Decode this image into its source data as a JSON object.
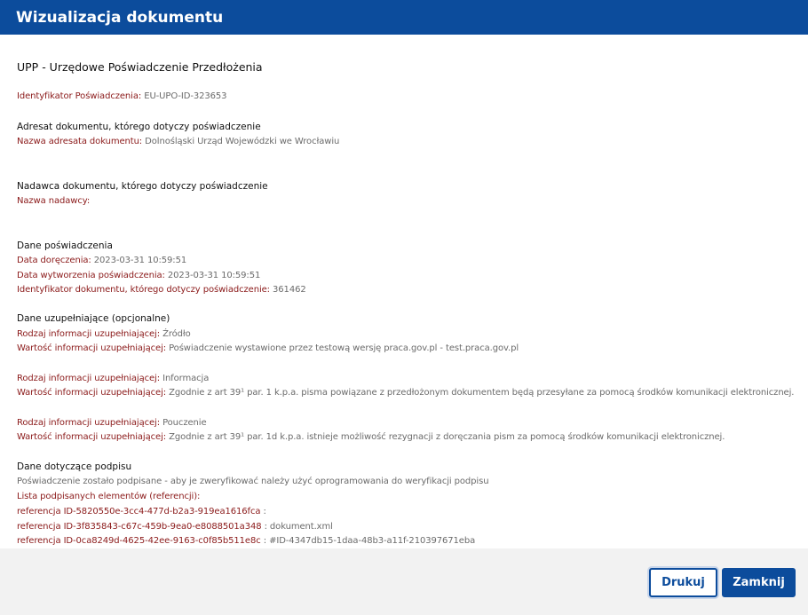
{
  "dialog": {
    "title": "Wizualizacja dokumentu"
  },
  "document": {
    "title": "UPP - Urzędowe Poświadczenie Przedłożenia",
    "identifier": {
      "label": "Identyfikator Poświadczenia:",
      "value": " EU-UPO-ID-323653"
    },
    "recipient": {
      "heading": "Adresat dokumentu, którego dotyczy poświadczenie",
      "name_label": "Nazwa adresata dokumentu:",
      "name_value": " Dolnośląski Urząd Wojewódzki we Wrocławiu"
    },
    "sender": {
      "heading": "Nadawca dokumentu, którego dotyczy poświadczenie",
      "name_label": "Nazwa nadawcy:",
      "name_value": ""
    },
    "certificate": {
      "heading": "Dane poświadczenia",
      "delivery_label": "Data doręczenia:",
      "delivery_value": " 2023-03-31 10:59:51",
      "created_label": "Data wytworzenia poświadczenia:",
      "created_value": " 2023-03-31 10:59:51",
      "docid_label": "Identyfikator dokumentu, którego dotyczy poświadczenie:",
      "docid_value": " 361462"
    },
    "supplementary": {
      "heading": "Dane uzupełniające (opcjonalne)",
      "type_label": "Rodzaj informacji uzupełniającej:",
      "value_label": "Wartość informacji uzupełniającej:",
      "items": [
        {
          "type": " Źródło",
          "value": " Poświadczenie wystawione przez testową wersję praca.gov.pl - test.praca.gov.pl"
        },
        {
          "type": " Informacja",
          "value": " Zgodnie z art 39¹ par. 1 k.p.a. pisma powiązane z przedłożonym dokumentem będą przesyłane za pomocą środków komunikacji elektronicznej."
        },
        {
          "type": " Pouczenie",
          "value": " Zgodnie z art 39¹ par. 1d k.p.a. istnieje możliwość rezygnacji z doręczania pism za pomocą środków komunikacji elektronicznej."
        }
      ]
    },
    "signature": {
      "heading": "Dane dotyczące podpisu",
      "note": "Poświadczenie zostało podpisane - aby je zweryfikować należy użyć oprogramowania do weryfikacji podpisu",
      "list_label": "Lista podpisanych elementów (referencji):",
      "references": [
        {
          "id": "referencja ID-5820550e-3cc4-477d-b2a3-919ea1616fca",
          "target": " :"
        },
        {
          "id": "referencja ID-3f835843-c67c-459b-9ea0-e8088501a348",
          "target": " : dokument.xml"
        },
        {
          "id": "referencja ID-0ca8249d-4625-42ee-9163-c0f85b511e8c",
          "target": " : #ID-4347db15-1daa-48b3-a11f-210397671eba"
        }
      ]
    }
  },
  "footer": {
    "print_label": "Drukuj",
    "close_label": "Zamknij"
  },
  "colors": {
    "header": "#0c4c9c",
    "label": "#8b1a1a",
    "value": "#6b6b6b",
    "footer": "#f2f2f2"
  }
}
